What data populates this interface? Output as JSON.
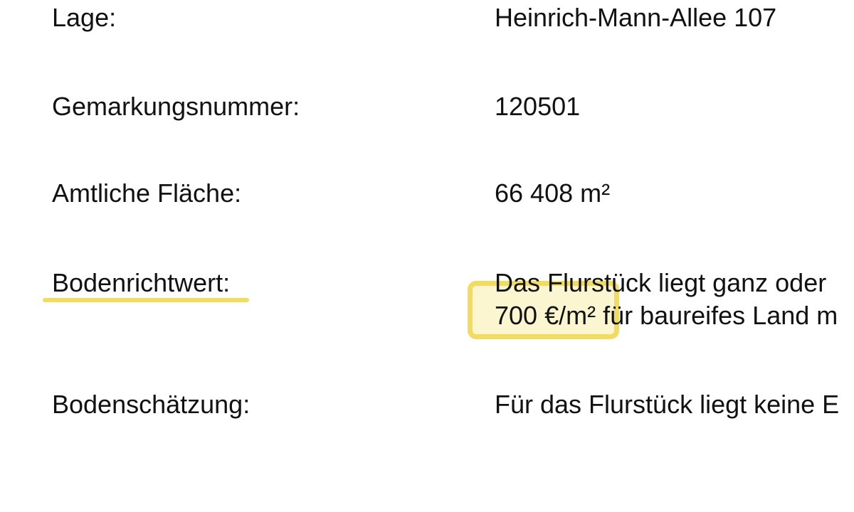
{
  "rows": {
    "lage": {
      "label": "Lage:",
      "value": "Heinrich-Mann-Allee 107"
    },
    "gemarkung": {
      "label": "Gemarkungsnummer:",
      "value": "120501"
    },
    "flaeche": {
      "label": "Amtliche Fläche:",
      "value": "66 408 m²"
    },
    "bodenrichtwert": {
      "label": "Bodenrichtwert:",
      "value_line1": "Das Flurstück liegt ganz oder",
      "value_line2": "700 €/m² für baureifes Land m"
    },
    "bodenschaetzung": {
      "label": "Bodenschätzung:",
      "value": "Für das Flurstück liegt keine E"
    }
  },
  "annotations": {
    "highlight_color": "#f2dc5d"
  }
}
